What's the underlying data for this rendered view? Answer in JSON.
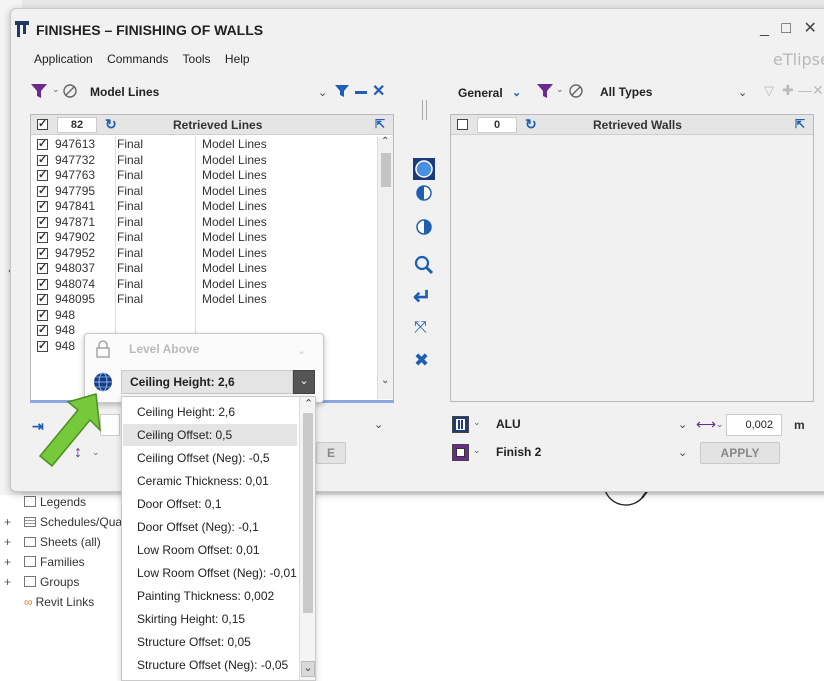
{
  "window": {
    "title": "FINISHES – FINISHING OF WALLS",
    "brand": "eTlipse",
    "controls": "_ □ ✕"
  },
  "menu": [
    "Application",
    "Commands",
    "Tools",
    "Help"
  ],
  "left_panel": {
    "filter_value": "Model Lines",
    "count": "82",
    "header_title": "Retrieved Lines",
    "rows": [
      {
        "id": "947613",
        "status": "Final",
        "type": "Model Lines"
      },
      {
        "id": "947732",
        "status": "Final",
        "type": "Model Lines"
      },
      {
        "id": "947763",
        "status": "Final",
        "type": "Model Lines"
      },
      {
        "id": "947795",
        "status": "Final",
        "type": "Model Lines"
      },
      {
        "id": "947841",
        "status": "Final",
        "type": "Model Lines"
      },
      {
        "id": "947871",
        "status": "Final",
        "type": "Model Lines"
      },
      {
        "id": "947902",
        "status": "Final",
        "type": "Model Lines"
      },
      {
        "id": "947952",
        "status": "Final",
        "type": "Model Lines"
      },
      {
        "id": "948037",
        "status": "Final",
        "type": "Model Lines"
      },
      {
        "id": "948074",
        "status": "Final",
        "type": "Model Lines"
      },
      {
        "id": "948095",
        "status": "Final",
        "type": "Model Lines"
      },
      {
        "id": "948",
        "status": "",
        "type": ""
      },
      {
        "id": "948",
        "status": "",
        "type": ""
      },
      {
        "id": "948",
        "status": "",
        "type": ""
      }
    ]
  },
  "right_panel": {
    "category": "General",
    "filter_value": "All Types",
    "count": "0",
    "header_title": "Retrieved Walls"
  },
  "bottom_right": {
    "material": "ALU",
    "offset_value": "0,002",
    "unit": "m",
    "finish": "Finish 2",
    "apply_label": "APPLY"
  },
  "bottom_left": {
    "e_button_label": "E"
  },
  "level_popup": {
    "level_above_label": "Level Above",
    "selected_height": "Ceiling Height: 2,6"
  },
  "height_options": [
    "Ceiling Height: 2,6",
    "Ceiling Offset: 0,5",
    "Ceiling Offset (Neg): -0,5",
    "Ceramic Thickness: 0,01",
    "Door Offset: 0,1",
    "Door Offset (Neg): -0,1",
    "Low Room Offset: 0,01",
    "Low Room Offset (Neg): -0,01",
    "Painting Thickness: 0,002",
    "Skirting Height: 0,15",
    "Structure Offset: 0,05",
    "Structure Offset (Neg): -0,05"
  ],
  "project_tree": [
    {
      "label": "Legends",
      "expandable": false
    },
    {
      "label": "Schedules/Qua",
      "expandable": true
    },
    {
      "label": "Sheets (all)",
      "expandable": true
    },
    {
      "label": "Families",
      "expandable": true
    },
    {
      "label": "Groups",
      "expandable": true
    },
    {
      "label": "Revit Links",
      "expandable": false
    }
  ],
  "colors": {
    "accent_blue": "#1f5fb3",
    "filter_purple": "#6b2a8c",
    "arrow_green": "#77c93c"
  }
}
